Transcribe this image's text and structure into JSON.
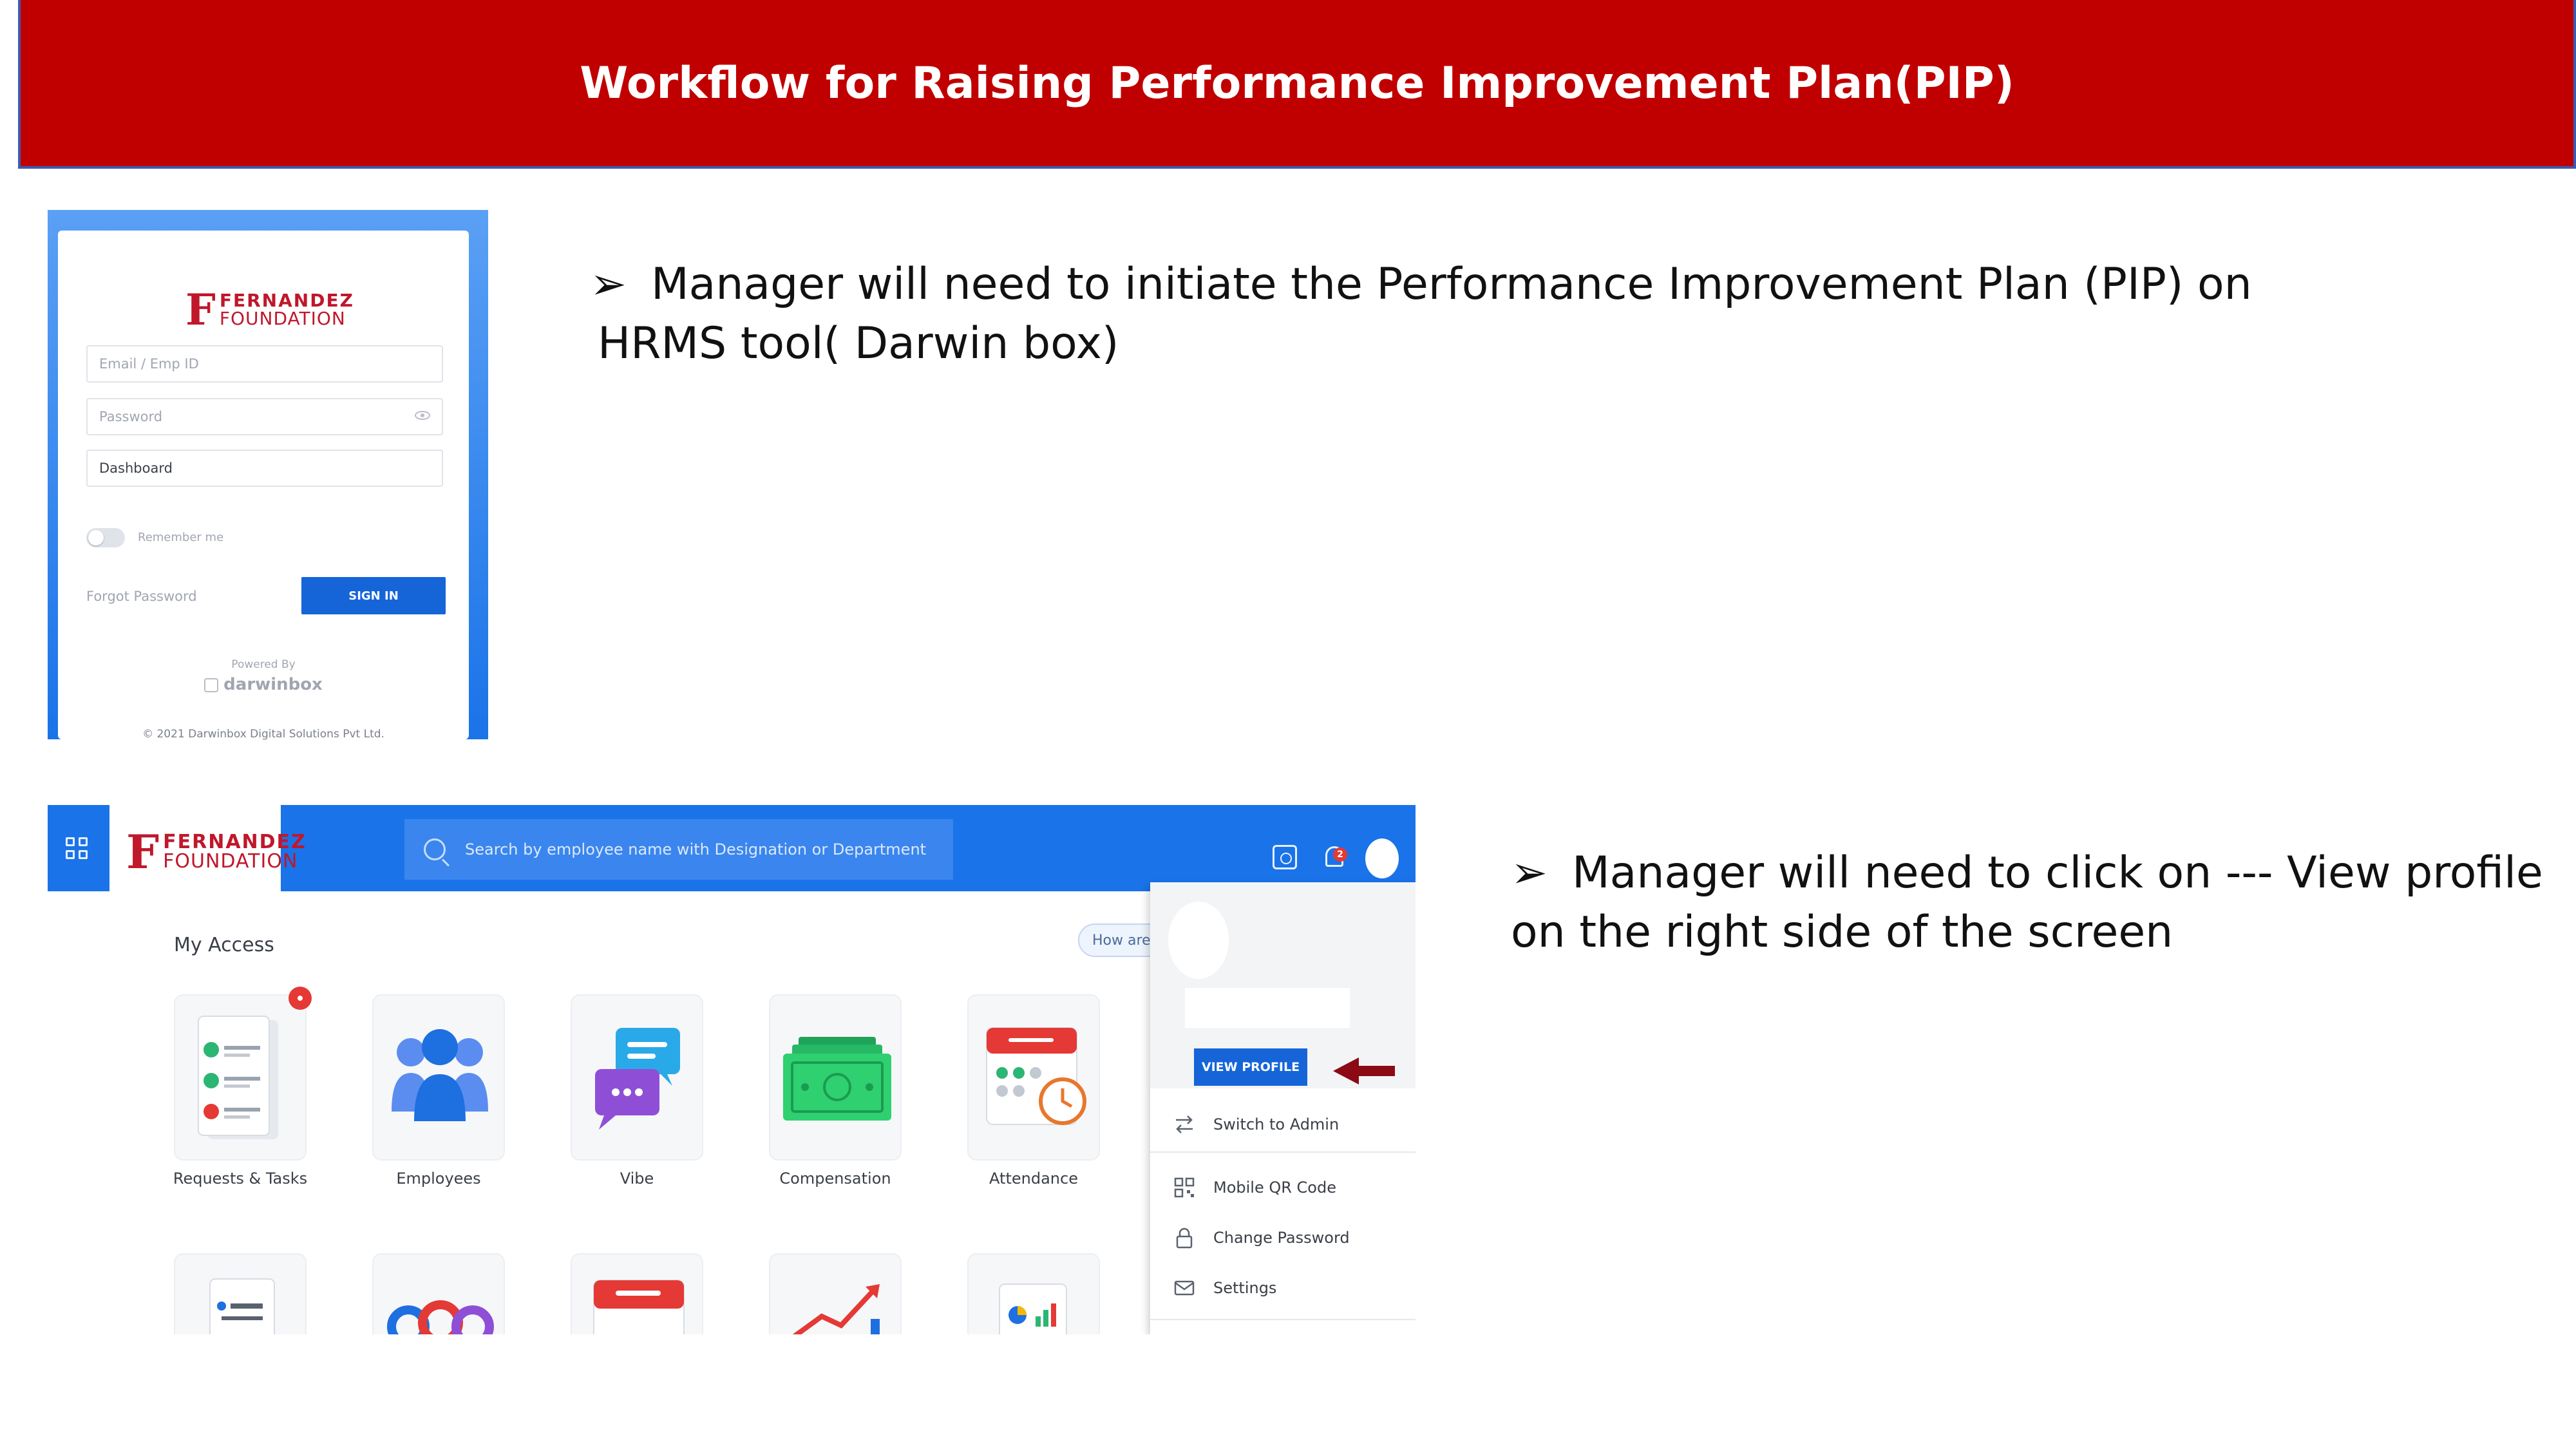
{
  "slide": {
    "title": "Workflow for Raising Performance Improvement Plan(PIP)",
    "bullet_arrow": "➢",
    "bullet1_line1": "Manager will need to initiate the Performance Improvement Plan (PIP) on",
    "bullet1_line2": "HRMS tool( Darwin box)",
    "bullet2_line1": "Manager will need to click on --- View profile",
    "bullet2_line2": "on the right side of the screen"
  },
  "login": {
    "brand_letter": "F",
    "brand_line1": "FERNANDEZ",
    "brand_line2": "FOUNDATION",
    "email_placeholder": "Email / Emp ID",
    "password_placeholder": "Password",
    "landing_value": "Dashboard",
    "remember_label": "Remember me",
    "forgot_label": "Forgot Password",
    "signin_label": "SIGN IN",
    "powered_by": "Powered By",
    "darwinbox": "darwinbox",
    "copyright": "© 2021 Darwinbox Digital Solutions Pvt Ltd."
  },
  "dashboard": {
    "brand_letter": "F",
    "brand_line1": "FERNANDEZ",
    "brand_line2": "FOUNDATION",
    "search_placeholder": "Search by employee name with Designation or Department",
    "notification_count": "2",
    "my_access": "My Access",
    "how_are_you": "How are y",
    "tiles": [
      {
        "label": "Requests & Tasks",
        "icon": "requests-tasks-icon"
      },
      {
        "label": "Employees",
        "icon": "employees-icon"
      },
      {
        "label": "Vibe",
        "icon": "vibe-icon"
      },
      {
        "label": "Compensation",
        "icon": "compensation-icon"
      },
      {
        "label": "Attendance",
        "icon": "attendance-icon"
      }
    ],
    "profile_menu": {
      "view_profile": "VIEW PROFILE",
      "items": [
        {
          "label": "Switch to Admin",
          "icon": "switch-icon"
        },
        {
          "label": "Mobile QR Code",
          "icon": "qr-code-icon"
        },
        {
          "label": "Change Password",
          "icon": "lock-icon"
        },
        {
          "label": "Settings",
          "icon": "settings-icon"
        }
      ]
    }
  },
  "colors": {
    "title_bg": "#c00000",
    "brand_red": "#c0172b",
    "darwin_blue": "#1a73e8",
    "arrow_red": "#8b0a14"
  }
}
